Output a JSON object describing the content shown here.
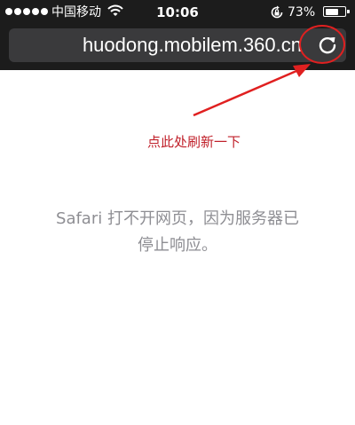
{
  "status_bar": {
    "carrier": "中国移动",
    "time": "10:06",
    "battery_percent": "73%",
    "battery_level": 0.73,
    "signal_dots": 5,
    "icons": [
      "signal-dots-icon",
      "wifi-icon",
      "rotation-lock-icon",
      "battery-icon"
    ]
  },
  "address_bar": {
    "url": "huodong.mobilem.360.cn",
    "reload_icon": "reload-icon"
  },
  "annotation": {
    "text": "点此处刷新一下",
    "color": "#c0202a",
    "circle_color": "#e02020"
  },
  "error": {
    "message": "Safari 打不开网页，因为服务器已停止响应。"
  },
  "colors": {
    "chrome": "#1c1c1c",
    "url_field": "#3a3a3c",
    "error_text": "#8e8e93"
  }
}
